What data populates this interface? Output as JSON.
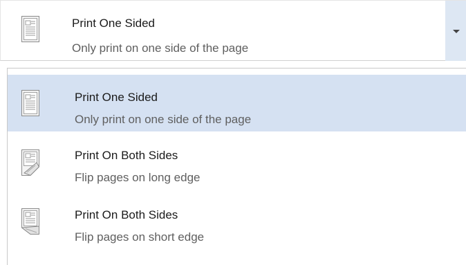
{
  "dropdown": {
    "selected_title": "Print One Sided",
    "selected_subtitle": "Only print on one side of the page",
    "selected_icon": "one-sided-page-icon",
    "arrow_icon": "chevron-down-icon"
  },
  "options": [
    {
      "title": "Print One Sided",
      "subtitle": "Only print on one side of the page",
      "icon": "one-sided-page-icon",
      "selected": true
    },
    {
      "title": "Print On Both Sides",
      "subtitle": "Flip pages on long edge",
      "icon": "flip-long-edge-icon",
      "selected": false
    },
    {
      "title": "Print On Both Sides",
      "subtitle": "Flip pages on short edge",
      "icon": "flip-short-edge-icon",
      "selected": false
    }
  ],
  "colors": {
    "selected_bg": "#d5e1f2",
    "arrow_area_bg": "#dde7f3",
    "title_text": "#1a1a1a",
    "subtitle_text": "#5f5f5f"
  }
}
